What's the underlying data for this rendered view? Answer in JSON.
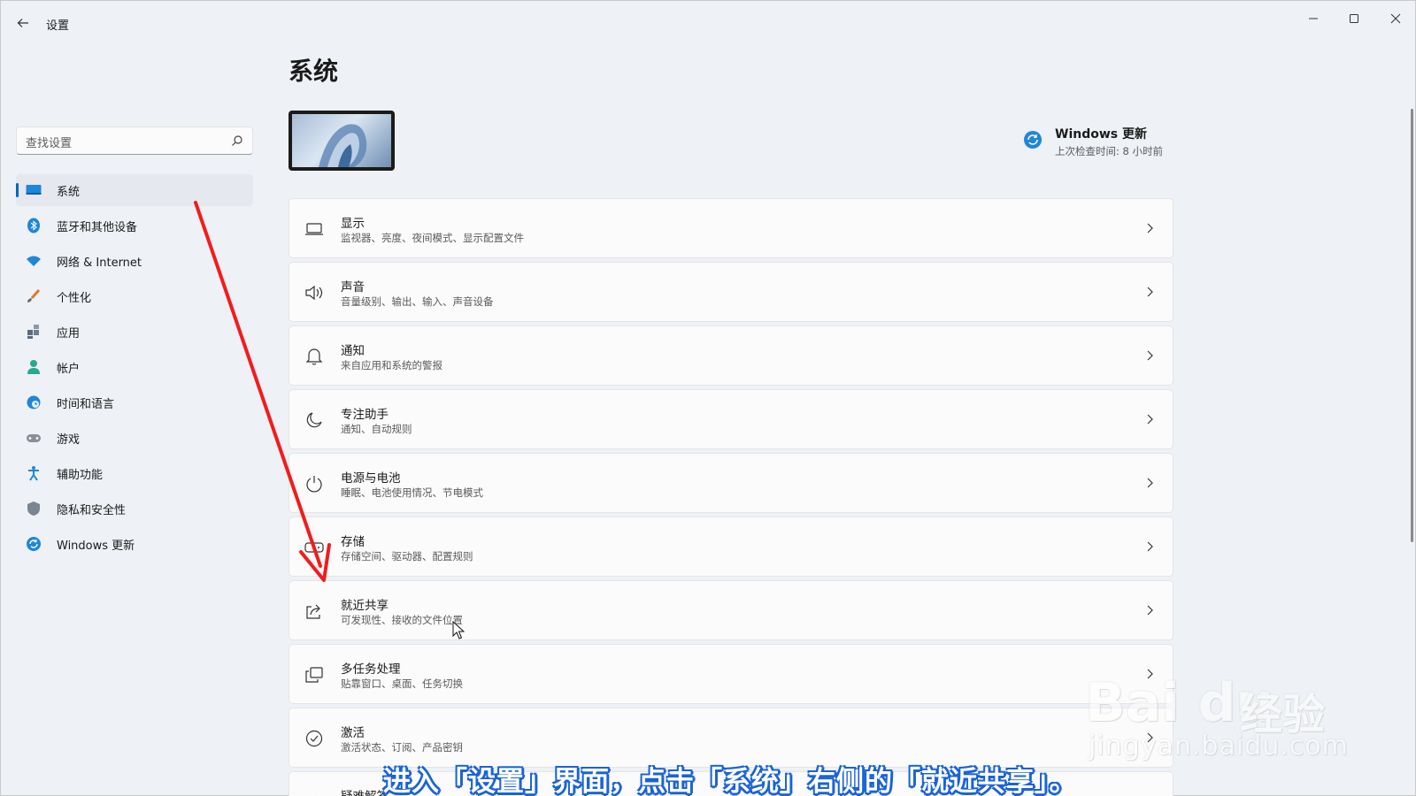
{
  "window": {
    "title": "设置",
    "controls": [
      "minimize-icon",
      "maximize-icon",
      "close-icon"
    ]
  },
  "sidebar": {
    "search_placeholder": "查找设置",
    "items": [
      {
        "label": "系统",
        "icon": "display-icon",
        "selected": true
      },
      {
        "label": "蓝牙和其他设备",
        "icon": "bluetooth-icon"
      },
      {
        "label": "网络 & Internet",
        "icon": "wifi-icon"
      },
      {
        "label": "个性化",
        "icon": "brush-icon"
      },
      {
        "label": "应用",
        "icon": "apps-icon"
      },
      {
        "label": "帐户",
        "icon": "person-icon"
      },
      {
        "label": "时间和语言",
        "icon": "globe-clock-icon"
      },
      {
        "label": "游戏",
        "icon": "gamepad-icon"
      },
      {
        "label": "辅助功能",
        "icon": "accessibility-icon"
      },
      {
        "label": "隐私和安全性",
        "icon": "shield-icon"
      },
      {
        "label": "Windows 更新",
        "icon": "sync-icon"
      }
    ]
  },
  "main": {
    "title": "系统",
    "update": {
      "title": "Windows 更新",
      "subtitle": "上次检查时间: 8 小时前"
    },
    "cards": [
      {
        "title": "显示",
        "subtitle": "监视器、亮度、夜间模式、显示配置文件",
        "icon": "laptop-icon"
      },
      {
        "title": "声音",
        "subtitle": "音量级别、输出、输入、声音设备",
        "icon": "speaker-icon"
      },
      {
        "title": "通知",
        "subtitle": "来自应用和系统的警报",
        "icon": "bell-icon"
      },
      {
        "title": "专注助手",
        "subtitle": "通知、自动规则",
        "icon": "moon-icon"
      },
      {
        "title": "电源与电池",
        "subtitle": "睡眠、电池使用情况、节电模式",
        "icon": "power-icon"
      },
      {
        "title": "存储",
        "subtitle": "存储空间、驱动器、配置规则",
        "icon": "storage-icon"
      },
      {
        "title": "就近共享",
        "subtitle": "可发现性、接收的文件位置",
        "icon": "share-icon"
      },
      {
        "title": "多任务处理",
        "subtitle": "贴靠窗口、桌面、任务切换",
        "icon": "multitask-icon"
      },
      {
        "title": "激活",
        "subtitle": "激活状态、订阅、产品密钥",
        "icon": "check-circle-icon"
      },
      {
        "title": "疑难解答",
        "subtitle": "",
        "icon": "wrench-icon"
      }
    ]
  },
  "overlay": {
    "caption": "进入「设置」界面，点击「系统」右侧的「就近共享」。",
    "watermark_brand": "Bai du",
    "watermark_suffix": "经验",
    "watermark_url": "jingyan.baidu.com",
    "arrow_color": "#f21c1c"
  },
  "colors": {
    "accent": "#0067c0",
    "caption_outline": "#1b63d6"
  }
}
